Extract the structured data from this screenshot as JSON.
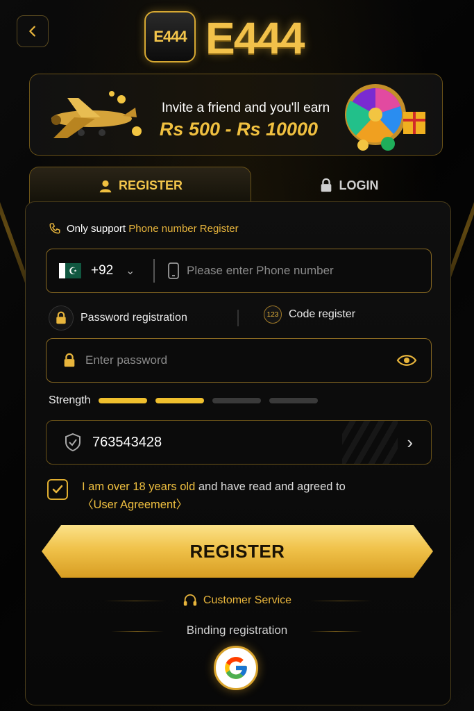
{
  "header": {
    "logo_badge": "E444",
    "logo_text": "E444",
    "back_icon": "chevron-left-icon"
  },
  "banner": {
    "line1": "Invite a friend and you'll earn",
    "line2": "Rs 500 - Rs 10000"
  },
  "tabs": [
    {
      "label": "REGISTER",
      "icon": "user-icon",
      "active": true
    },
    {
      "label": "LOGIN",
      "icon": "lock-icon",
      "active": false
    }
  ],
  "form": {
    "support_prefix": "Only support ",
    "support_highlight": "Phone number Register",
    "country_code": "+92",
    "phone_placeholder": "Please enter Phone number",
    "mode_password": "Password registration",
    "mode_code": "Code register",
    "mode_code_icon_text": "123",
    "password_placeholder": "Enter password",
    "strength_label": "Strength",
    "strength_level": 2,
    "strength_max": 4,
    "invite_code": "763543428",
    "agree_prefix": "I am ",
    "agree_highlight": "over 18 years old",
    "agree_mid": " and have read and agreed to",
    "agree_link": "〈User Agreement〉",
    "agree_checked": true,
    "register_button": "REGISTER",
    "customer_service": "Customer Service",
    "binding_registration": "Binding registration"
  },
  "colors": {
    "accent": "#f0c040",
    "border": "#8a6a22",
    "background": "#050505"
  }
}
